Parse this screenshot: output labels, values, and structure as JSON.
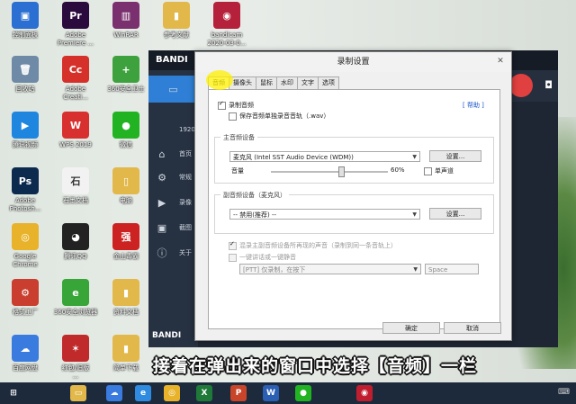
{
  "desktop": {
    "icons": [
      {
        "label": "控制面板",
        "glyph": "▣",
        "color": "#2a6fd1"
      },
      {
        "label": "Adobe\nPremiere ...",
        "glyph": "Pr",
        "color": "#2b0a3d"
      },
      {
        "label": "WinRAR",
        "glyph": "▥",
        "color": "#7a2f6e"
      },
      {
        "label": "参考文献",
        "glyph": "▮",
        "color": "#e2b84a"
      },
      {
        "label": "bandicam\n2020-03-0...",
        "glyph": "◉",
        "color": "#b5203a"
      },
      {
        "label": "回收站",
        "glyph": "🗑",
        "color": "#6e8aa6"
      },
      {
        "label": "Adobe\nCreati...",
        "glyph": "Cc",
        "color": "#d5302a"
      },
      {
        "label": "360安全卫士",
        "glyph": "+",
        "color": "#3da23d"
      },
      {
        "label": "腾讯视频",
        "glyph": "▶",
        "color": "#1f86e0"
      },
      {
        "label": "WPS 2019",
        "glyph": "W",
        "color": "#d8302e"
      },
      {
        "label": "微信",
        "glyph": "●",
        "color": "#22b322"
      },
      {
        "label": "Adobe\nPhotosh...",
        "glyph": "Ps",
        "color": "#0b2a4e"
      },
      {
        "label": "石墨文档",
        "glyph": "石",
        "color": "#f2f2f2"
      },
      {
        "label": "电脑",
        "glyph": "▯",
        "color": "#e2b84a"
      },
      {
        "label": "Google\nChrome",
        "glyph": "◎",
        "color": "#e8b32a"
      },
      {
        "label": "腾讯QQ",
        "glyph": "◕",
        "color": "#222222"
      },
      {
        "label": "金山毒霸",
        "glyph": "强",
        "color": "#cc2222"
      },
      {
        "label": "格式工厂",
        "glyph": "⚙",
        "color": "#c93e2e"
      },
      {
        "label": "360安全浏览器",
        "glyph": "e",
        "color": "#37a537"
      },
      {
        "label": "资料文档",
        "glyph": "▮",
        "color": "#e2b84a"
      },
      {
        "label": "百度网盘",
        "glyph": "☁",
        "color": "#3a7be0"
      },
      {
        "label": "红包/旧版\n...",
        "glyph": "✶",
        "color": "#c02a2a"
      },
      {
        "label": "简单下载",
        "glyph": "▮",
        "color": "#e2b84a"
      }
    ]
  },
  "bandicam": {
    "title": "BANDI",
    "resolution": "1920×",
    "side_items": [
      "首页",
      "常规",
      "录像",
      "截图",
      "关于"
    ],
    "footer": "BANDI"
  },
  "dialog": {
    "title": "录制设置",
    "close": "✕",
    "tabs": [
      "音频",
      "摄像头",
      "鼠标",
      "水印",
      "文字",
      "选项"
    ],
    "record_audio": "录制音频",
    "save_separate": "保存音频单独录音音轨（.wav）",
    "help": "[ 帮助 ]",
    "main_device_group": "主音频设备",
    "main_device_value": "麦克风 (Intel SST Audio Device (WDM))",
    "settings_btn": "设置...",
    "volume_label": "音量",
    "volume_value": "60%",
    "volume_level": 0.6,
    "mono_label": "单声道",
    "sub_device_group": "副音频设备（麦克风）",
    "sub_device_value": "-- 禁用(推荐) --",
    "settings_btn2": "设置...",
    "mix_label": "混录主副音频设备所再现的声音（录制到同一条音轨上）",
    "onekey_label": "一键讲话或一键静音",
    "ptt_value": "[PTT] 仅录制，在按下",
    "ptt_key": "Space",
    "ok": "确定",
    "cancel": "取消"
  },
  "caption": "接着在弹出来的窗口中选择【音频】一栏",
  "taskbar": {
    "icons": [
      {
        "glyph": "⊞",
        "color": "#1c2a3c"
      },
      {
        "glyph": "▭",
        "color": "#e2b84a"
      },
      {
        "glyph": "☁",
        "color": "#3a7be0"
      },
      {
        "glyph": "e",
        "color": "#2f8be0"
      },
      {
        "glyph": "◎",
        "color": "#e8b32a"
      },
      {
        "glyph": "X",
        "color": "#1f7a3a"
      },
      {
        "glyph": "P",
        "color": "#c9452a"
      },
      {
        "glyph": "W",
        "color": "#2b5fb3"
      },
      {
        "glyph": "●",
        "color": "#22b322"
      },
      {
        "glyph": "◉",
        "color": "#c01e2e"
      }
    ]
  }
}
